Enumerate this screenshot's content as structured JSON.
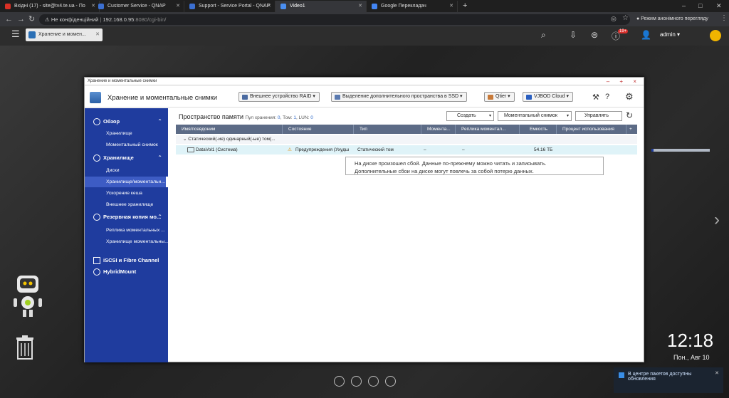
{
  "browser": {
    "tabs": [
      {
        "label": "Вхідні (17) - site@tv4.te.ua - По",
        "color": "#d93025",
        "active": false
      },
      {
        "label": "Customer Service - QNAP",
        "color": "#3b6fd1",
        "active": false
      },
      {
        "label": "Support - Service Portal - QNAP",
        "color": "#3b6fd1",
        "active": false
      },
      {
        "label": "Video1",
        "color": "#4a8ef0",
        "active": true
      },
      {
        "label": "Google Перекладач",
        "color": "#4285f4",
        "active": false
      }
    ],
    "new_tab": "+",
    "win_controls": {
      "min": "–",
      "max": "□",
      "close": "✕"
    },
    "security_label": "Не конфіденційний",
    "url_host": "192.168.0.95",
    "url_rest": ":8080/cgi-bin/",
    "incognito": "Режим анонімного перегляду"
  },
  "qts": {
    "app_tab": "Хранение и момен...",
    "badge": "19+",
    "user": "admin ▾"
  },
  "window": {
    "titlebar": "Хранение и моментальные снимки",
    "controls": "– + ×",
    "app_title": "Хранение и моментальные снимки",
    "buttons": {
      "raid": "Внешнее устройство RAID",
      "ssd": "Выделение дополнительного пространства в SSD",
      "qtier": "Qtier",
      "vjbod": "VJBOD Cloud"
    }
  },
  "sidebar": {
    "overview": "Обзор",
    "overview_items": [
      "Хранилище",
      "Моментальный снимок"
    ],
    "storage": "Хранилище",
    "storage_items": [
      "Диски",
      "Хранилище/моментальн...",
      "Ускорение кеша",
      "Внешнее хранилище"
    ],
    "backup": "Резервная копия мо...",
    "backup_items": [
      "Реплика моментальных ...",
      "Хранилище моментальны..."
    ],
    "iscsi": "iSCSI и Fibre Channel",
    "hybridmount": "HybridMount",
    "caret_up": "⌃"
  },
  "main": {
    "title": "Пространство памяти",
    "meta_pool": "Пул хранения: ",
    "pool_n": "0",
    "meta_vol": ", Том: ",
    "vol_n": "1",
    "meta_lun": ", LUN: ",
    "lun_n": "0",
    "create": "Создать",
    "snapshot": "Моментальный снимок",
    "manage": "Управлять",
    "columns": [
      "Имя/псевдоним",
      "Состояние",
      "Тип",
      "Момента...",
      "Реплика моментал...",
      "Емкость",
      "Процент использования",
      "+"
    ],
    "group_label": "Статический(-ие) одинарный(-ые) том(...",
    "row": {
      "name": "DataVol1 (Система)",
      "status": "Предупреждения (Ухудш",
      "type": "Статический том",
      "snap": "–",
      "replica": "–",
      "capacity": "54.16 ТБ",
      "usage_fraction": 0.04
    },
    "tooltip_line1": "На диске произошел сбой. Данные по-прежнему можно читать и записывать.",
    "tooltip_line2": "Дополнительные сбои на диске могут повлечь за собой потерю данных."
  },
  "desktop": {
    "time": "12:18",
    "date": "Пон., Авг 10",
    "notification": "В центре пакетов доступны обновления"
  }
}
